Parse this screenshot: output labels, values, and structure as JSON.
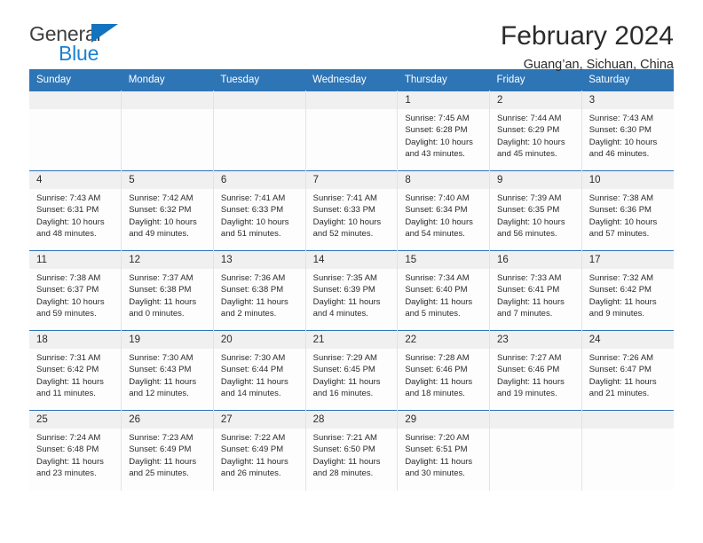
{
  "brand": {
    "line1": "General",
    "line2": "Blue",
    "triangle_color": "#1273bf",
    "text_color": "#3f3f3f",
    "blue_text_color": "#1b81d4"
  },
  "header": {
    "title": "February 2024",
    "subtitle": "Guang’an, Sichuan, China"
  },
  "theme": {
    "header_blue": "#2e75b6",
    "daynum_band": "#f0f0f0",
    "cell_border": "#e2e2e2"
  },
  "weekday_headers": [
    "Sunday",
    "Monday",
    "Tuesday",
    "Wednesday",
    "Thursday",
    "Friday",
    "Saturday"
  ],
  "weeks": [
    [
      {
        "day": "",
        "sunrise": "",
        "sunset": "",
        "daylight_line1": "",
        "daylight_line2": "",
        "empty": true
      },
      {
        "day": "",
        "sunrise": "",
        "sunset": "",
        "daylight_line1": "",
        "daylight_line2": "",
        "empty": true
      },
      {
        "day": "",
        "sunrise": "",
        "sunset": "",
        "daylight_line1": "",
        "daylight_line2": "",
        "empty": true
      },
      {
        "day": "",
        "sunrise": "",
        "sunset": "",
        "daylight_line1": "",
        "daylight_line2": "",
        "empty": true
      },
      {
        "day": "1",
        "sunrise": "Sunrise: 7:45 AM",
        "sunset": "Sunset: 6:28 PM",
        "daylight_line1": "Daylight: 10 hours",
        "daylight_line2": "and 43 minutes."
      },
      {
        "day": "2",
        "sunrise": "Sunrise: 7:44 AM",
        "sunset": "Sunset: 6:29 PM",
        "daylight_line1": "Daylight: 10 hours",
        "daylight_line2": "and 45 minutes."
      },
      {
        "day": "3",
        "sunrise": "Sunrise: 7:43 AM",
        "sunset": "Sunset: 6:30 PM",
        "daylight_line1": "Daylight: 10 hours",
        "daylight_line2": "and 46 minutes."
      }
    ],
    [
      {
        "day": "4",
        "sunrise": "Sunrise: 7:43 AM",
        "sunset": "Sunset: 6:31 PM",
        "daylight_line1": "Daylight: 10 hours",
        "daylight_line2": "and 48 minutes."
      },
      {
        "day": "5",
        "sunrise": "Sunrise: 7:42 AM",
        "sunset": "Sunset: 6:32 PM",
        "daylight_line1": "Daylight: 10 hours",
        "daylight_line2": "and 49 minutes."
      },
      {
        "day": "6",
        "sunrise": "Sunrise: 7:41 AM",
        "sunset": "Sunset: 6:33 PM",
        "daylight_line1": "Daylight: 10 hours",
        "daylight_line2": "and 51 minutes."
      },
      {
        "day": "7",
        "sunrise": "Sunrise: 7:41 AM",
        "sunset": "Sunset: 6:33 PM",
        "daylight_line1": "Daylight: 10 hours",
        "daylight_line2": "and 52 minutes."
      },
      {
        "day": "8",
        "sunrise": "Sunrise: 7:40 AM",
        "sunset": "Sunset: 6:34 PM",
        "daylight_line1": "Daylight: 10 hours",
        "daylight_line2": "and 54 minutes."
      },
      {
        "day": "9",
        "sunrise": "Sunrise: 7:39 AM",
        "sunset": "Sunset: 6:35 PM",
        "daylight_line1": "Daylight: 10 hours",
        "daylight_line2": "and 56 minutes."
      },
      {
        "day": "10",
        "sunrise": "Sunrise: 7:38 AM",
        "sunset": "Sunset: 6:36 PM",
        "daylight_line1": "Daylight: 10 hours",
        "daylight_line2": "and 57 minutes."
      }
    ],
    [
      {
        "day": "11",
        "sunrise": "Sunrise: 7:38 AM",
        "sunset": "Sunset: 6:37 PM",
        "daylight_line1": "Daylight: 10 hours",
        "daylight_line2": "and 59 minutes."
      },
      {
        "day": "12",
        "sunrise": "Sunrise: 7:37 AM",
        "sunset": "Sunset: 6:38 PM",
        "daylight_line1": "Daylight: 11 hours",
        "daylight_line2": "and 0 minutes."
      },
      {
        "day": "13",
        "sunrise": "Sunrise: 7:36 AM",
        "sunset": "Sunset: 6:38 PM",
        "daylight_line1": "Daylight: 11 hours",
        "daylight_line2": "and 2 minutes."
      },
      {
        "day": "14",
        "sunrise": "Sunrise: 7:35 AM",
        "sunset": "Sunset: 6:39 PM",
        "daylight_line1": "Daylight: 11 hours",
        "daylight_line2": "and 4 minutes."
      },
      {
        "day": "15",
        "sunrise": "Sunrise: 7:34 AM",
        "sunset": "Sunset: 6:40 PM",
        "daylight_line1": "Daylight: 11 hours",
        "daylight_line2": "and 5 minutes."
      },
      {
        "day": "16",
        "sunrise": "Sunrise: 7:33 AM",
        "sunset": "Sunset: 6:41 PM",
        "daylight_line1": "Daylight: 11 hours",
        "daylight_line2": "and 7 minutes."
      },
      {
        "day": "17",
        "sunrise": "Sunrise: 7:32 AM",
        "sunset": "Sunset: 6:42 PM",
        "daylight_line1": "Daylight: 11 hours",
        "daylight_line2": "and 9 minutes."
      }
    ],
    [
      {
        "day": "18",
        "sunrise": "Sunrise: 7:31 AM",
        "sunset": "Sunset: 6:42 PM",
        "daylight_line1": "Daylight: 11 hours",
        "daylight_line2": "and 11 minutes."
      },
      {
        "day": "19",
        "sunrise": "Sunrise: 7:30 AM",
        "sunset": "Sunset: 6:43 PM",
        "daylight_line1": "Daylight: 11 hours",
        "daylight_line2": "and 12 minutes."
      },
      {
        "day": "20",
        "sunrise": "Sunrise: 7:30 AM",
        "sunset": "Sunset: 6:44 PM",
        "daylight_line1": "Daylight: 11 hours",
        "daylight_line2": "and 14 minutes."
      },
      {
        "day": "21",
        "sunrise": "Sunrise: 7:29 AM",
        "sunset": "Sunset: 6:45 PM",
        "daylight_line1": "Daylight: 11 hours",
        "daylight_line2": "and 16 minutes."
      },
      {
        "day": "22",
        "sunrise": "Sunrise: 7:28 AM",
        "sunset": "Sunset: 6:46 PM",
        "daylight_line1": "Daylight: 11 hours",
        "daylight_line2": "and 18 minutes."
      },
      {
        "day": "23",
        "sunrise": "Sunrise: 7:27 AM",
        "sunset": "Sunset: 6:46 PM",
        "daylight_line1": "Daylight: 11 hours",
        "daylight_line2": "and 19 minutes."
      },
      {
        "day": "24",
        "sunrise": "Sunrise: 7:26 AM",
        "sunset": "Sunset: 6:47 PM",
        "daylight_line1": "Daylight: 11 hours",
        "daylight_line2": "and 21 minutes."
      }
    ],
    [
      {
        "day": "25",
        "sunrise": "Sunrise: 7:24 AM",
        "sunset": "Sunset: 6:48 PM",
        "daylight_line1": "Daylight: 11 hours",
        "daylight_line2": "and 23 minutes."
      },
      {
        "day": "26",
        "sunrise": "Sunrise: 7:23 AM",
        "sunset": "Sunset: 6:49 PM",
        "daylight_line1": "Daylight: 11 hours",
        "daylight_line2": "and 25 minutes."
      },
      {
        "day": "27",
        "sunrise": "Sunrise: 7:22 AM",
        "sunset": "Sunset: 6:49 PM",
        "daylight_line1": "Daylight: 11 hours",
        "daylight_line2": "and 26 minutes."
      },
      {
        "day": "28",
        "sunrise": "Sunrise: 7:21 AM",
        "sunset": "Sunset: 6:50 PM",
        "daylight_line1": "Daylight: 11 hours",
        "daylight_line2": "and 28 minutes."
      },
      {
        "day": "29",
        "sunrise": "Sunrise: 7:20 AM",
        "sunset": "Sunset: 6:51 PM",
        "daylight_line1": "Daylight: 11 hours",
        "daylight_line2": "and 30 minutes."
      },
      {
        "day": "",
        "sunrise": "",
        "sunset": "",
        "daylight_line1": "",
        "daylight_line2": "",
        "empty": true
      },
      {
        "day": "",
        "sunrise": "",
        "sunset": "",
        "daylight_line1": "",
        "daylight_line2": "",
        "empty": true
      }
    ]
  ]
}
